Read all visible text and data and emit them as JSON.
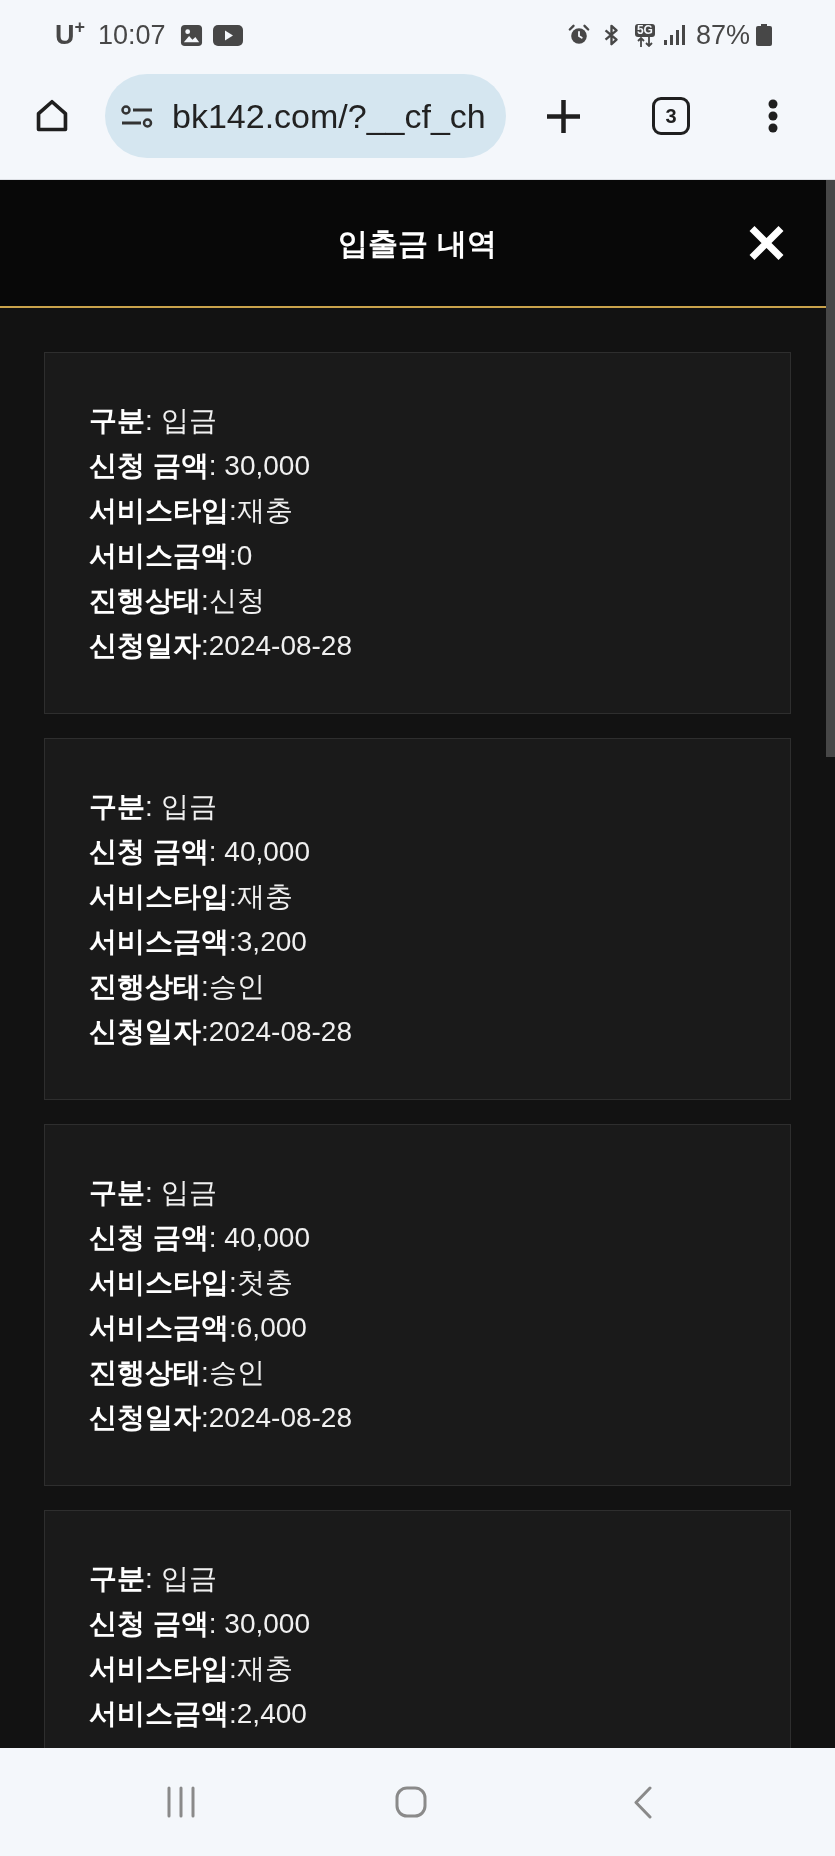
{
  "status_bar": {
    "carrier": "U$^{+}$",
    "time": "10:07",
    "network_type": "5G",
    "battery": "87%"
  },
  "browser": {
    "url": "bk142.com/?__cf_ch",
    "tab_count": "3"
  },
  "header": {
    "title": "입출금 내역"
  },
  "records": [
    {
      "lines": [
        "**구분**: 입금",
        "**신청 금액**: 30,000",
        "**서비스타입**:재충",
        "**서비스금액**:0",
        "**진행상태**:신청",
        "**신청일자**:2024-08-28"
      ]
    },
    {
      "lines": [
        "**구분**: 입금",
        "**신청 금액**: 40,000",
        "**서비스타입**:재충",
        "**서비스금액**:3,200",
        "**진행상태**:승인",
        "**신청일자**:2024-08-28"
      ]
    },
    {
      "lines": [
        "**구분**: 입금",
        "**신청 금액**: 40,000",
        "**서비스타입**:첫충",
        "**서비스금액**:6,000",
        "**진행상태**:승인",
        "**신청일자**:2024-08-28"
      ]
    },
    {
      "lines": [
        "**구분**: 입금",
        "**신청 금액**: 30,000",
        "**서비스타입**:재충",
        "**서비스금액**:2,400"
      ]
    }
  ]
}
